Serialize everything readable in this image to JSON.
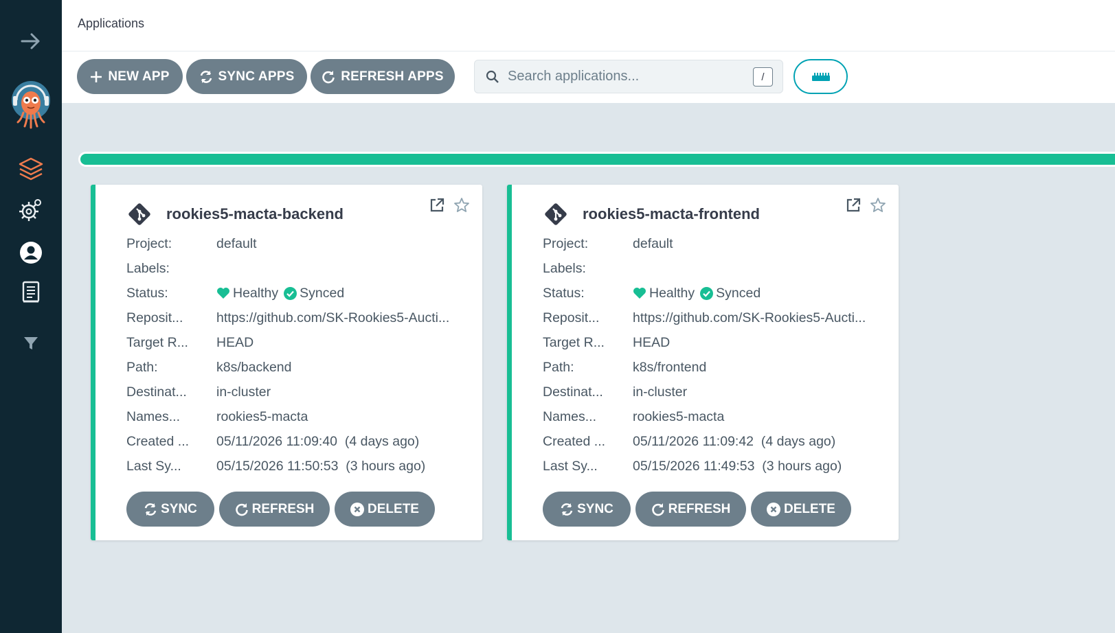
{
  "header": {
    "title": "Applications"
  },
  "toolbar": {
    "new_app": "NEW APP",
    "sync_apps": "SYNC APPS",
    "refresh_apps": "REFRESH APPS",
    "search_placeholder": "Search applications...",
    "search_shortcut": "/"
  },
  "sidebar": {
    "items": [
      "expand-arrow-icon",
      "argo-logo",
      "applications-icon",
      "settings-icon",
      "user-icon",
      "docs-icon",
      "filter-icon"
    ]
  },
  "progress": {
    "healthy_fraction": 1.0
  },
  "colors": {
    "accent": "#18be94",
    "button": "#6d7f8b",
    "sidebar": "#0f2733",
    "teal": "#00a2b3",
    "brand": "#ef7b4d"
  },
  "cards": [
    {
      "title": "rookies5-macta-backend",
      "rows": [
        {
          "key": "Project:",
          "value": "default"
        },
        {
          "key": "Labels:",
          "value": ""
        },
        {
          "key": "Status:",
          "health": "Healthy",
          "sync": "Synced"
        },
        {
          "key": "Reposit...",
          "value": "https://github.com/SK-Rookies5-Aucti..."
        },
        {
          "key": "Target R...",
          "value": "HEAD"
        },
        {
          "key": "Path:",
          "value": "k8s/backend"
        },
        {
          "key": "Destinat...",
          "value": "in-cluster"
        },
        {
          "key": "Names...",
          "value": "rookies5-macta"
        },
        {
          "key": "Created ...",
          "value": "05/11/2026 11:09:40  (4 days ago)"
        },
        {
          "key": "Last Sy...",
          "value": "05/15/2026 11:50:53  (3 hours ago)"
        }
      ],
      "buttons": {
        "sync": "SYNC",
        "refresh": "REFRESH",
        "delete": "DELETE"
      }
    },
    {
      "title": "rookies5-macta-frontend",
      "rows": [
        {
          "key": "Project:",
          "value": "default"
        },
        {
          "key": "Labels:",
          "value": ""
        },
        {
          "key": "Status:",
          "health": "Healthy",
          "sync": "Synced"
        },
        {
          "key": "Reposit...",
          "value": "https://github.com/SK-Rookies5-Aucti..."
        },
        {
          "key": "Target R...",
          "value": "HEAD"
        },
        {
          "key": "Path:",
          "value": "k8s/frontend"
        },
        {
          "key": "Destinat...",
          "value": "in-cluster"
        },
        {
          "key": "Names...",
          "value": "rookies5-macta"
        },
        {
          "key": "Created ...",
          "value": "05/11/2026 11:09:42  (4 days ago)"
        },
        {
          "key": "Last Sy...",
          "value": "05/15/2026 11:49:53  (3 hours ago)"
        }
      ],
      "buttons": {
        "sync": "SYNC",
        "refresh": "REFRESH",
        "delete": "DELETE"
      }
    }
  ]
}
